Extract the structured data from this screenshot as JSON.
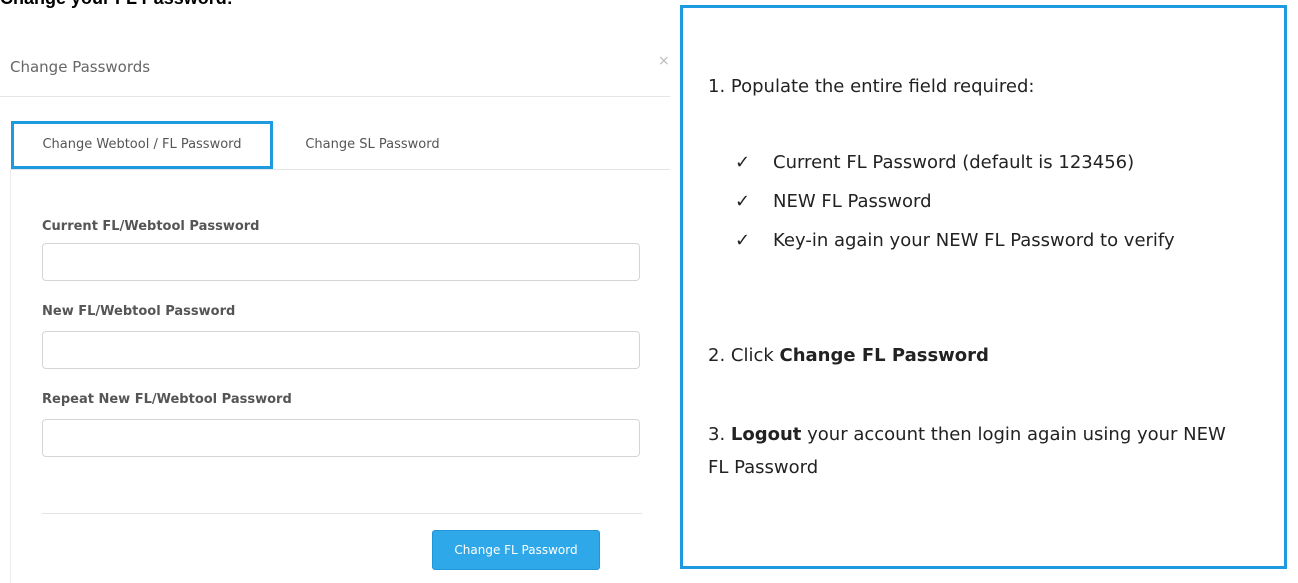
{
  "page_heading": "Change your FL Password:",
  "modal": {
    "title": "Change Passwords",
    "close_symbol": "×",
    "tabs": [
      {
        "label": "Change Webtool / FL Password",
        "active": true
      },
      {
        "label": "Change SL Password",
        "active": false
      }
    ],
    "fields": [
      {
        "label": "Current FL/Webtool Password",
        "value": "",
        "placeholder": ""
      },
      {
        "label": "New FL/Webtool Password",
        "value": "",
        "placeholder": ""
      },
      {
        "label": "Repeat New FL/Webtool Password",
        "value": "",
        "placeholder": ""
      }
    ],
    "submit_label": "Change FL Password"
  },
  "instructions": {
    "step1": "1. Populate the entire field required:",
    "checklist": [
      "Current FL Password (default is 123456)",
      "NEW FL Password",
      "Key-in again your NEW FL Password to verify"
    ],
    "check_symbol": "✓",
    "step2_prefix": "2. Click ",
    "step2_bold": "Change FL Password",
    "step3_prefix": "3. ",
    "step3_bold": "Logout",
    "step3_rest": " your account then login again using your NEW FL Password"
  },
  "colors": {
    "accent_border": "#1e9be0",
    "button_bg": "#2fa8ea"
  }
}
